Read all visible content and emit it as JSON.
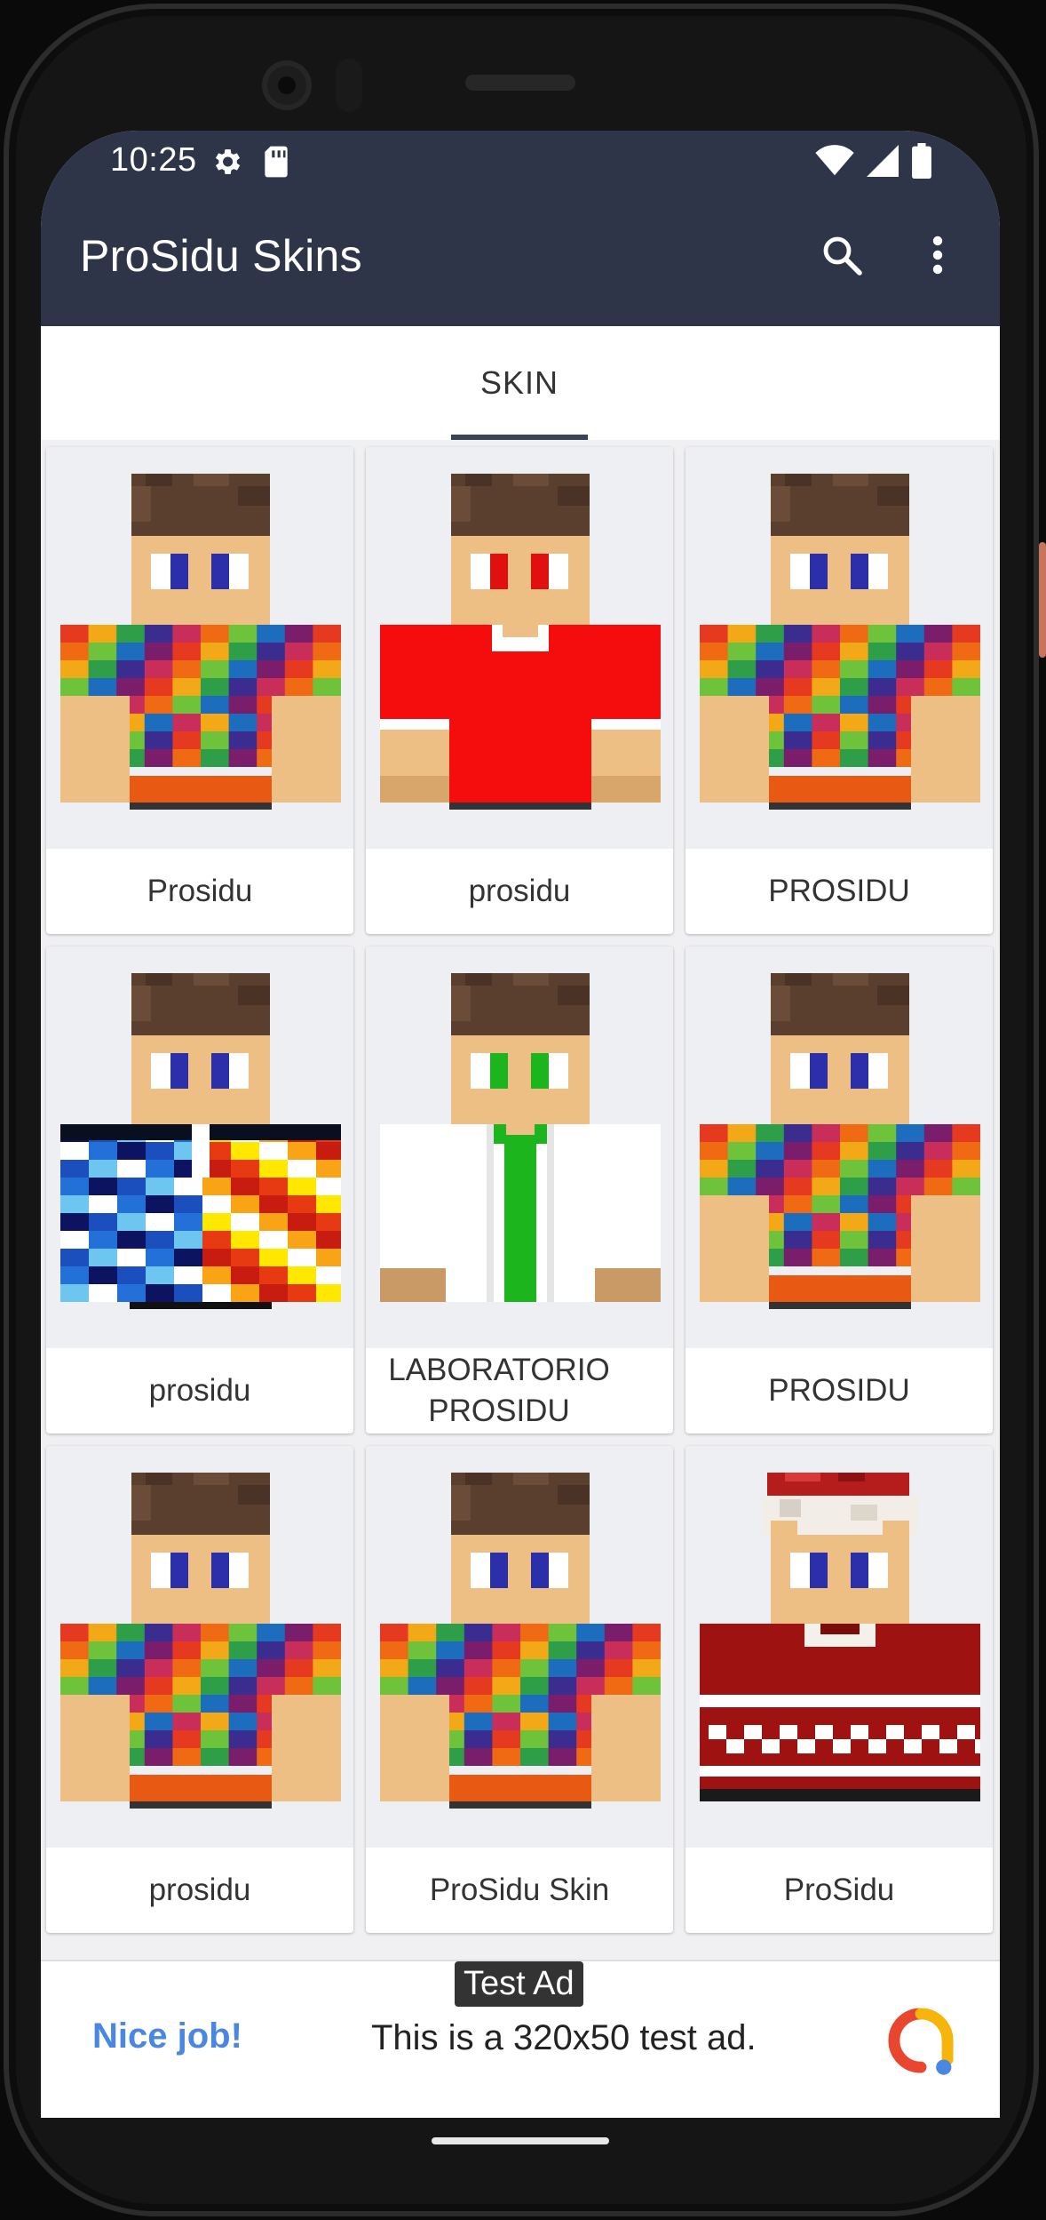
{
  "status_bar": {
    "time": "10:25"
  },
  "app_bar": {
    "title": "ProSidu Skins",
    "search_icon": "search-icon",
    "menu_icon": "more-vert-icon"
  },
  "tabs": [
    {
      "label": "SKIN",
      "active": true
    }
  ],
  "skins": [
    {
      "label": "Prosidu",
      "style": "tiedye"
    },
    {
      "label": "prosidu",
      "style": "red"
    },
    {
      "label": "PROSIDU",
      "style": "tiedye"
    },
    {
      "label": "prosidu",
      "style": "fireice"
    },
    {
      "label": "LABORATORIO PROSIDU",
      "style": "lab"
    },
    {
      "label": "PROSIDU",
      "style": "tiedye"
    },
    {
      "label": "prosidu",
      "style": "tiedye"
    },
    {
      "label": "ProSidu Skin",
      "style": "tiedye"
    },
    {
      "label": "ProSidu",
      "style": "xmas"
    }
  ],
  "ad": {
    "tag": "Test Ad",
    "title": "Nice job!",
    "body": "This is a 320x50 test ad."
  },
  "colors": {
    "app_bar": "#2e3548",
    "accent": "#3b4358",
    "ad_title": "#4a87e0"
  }
}
